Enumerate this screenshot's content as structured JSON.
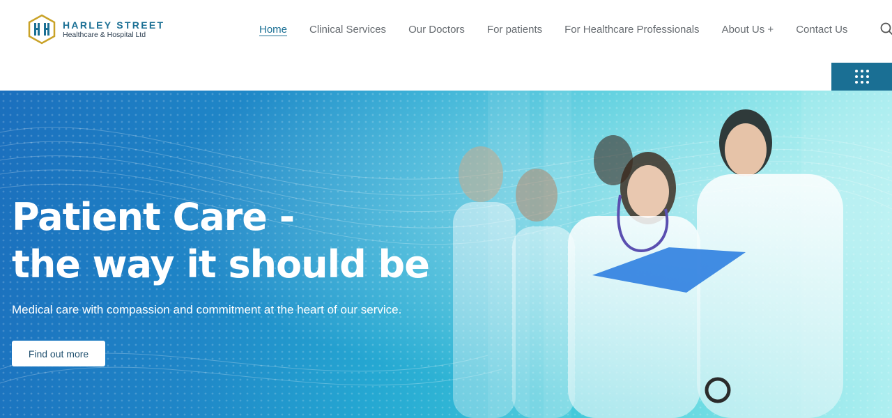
{
  "logo": {
    "title": "HARLEY STREET",
    "subtitle": "Healthcare & Hospital Ltd"
  },
  "nav": {
    "items": [
      {
        "label": "Home",
        "active": true
      },
      {
        "label": "Clinical Services",
        "active": false
      },
      {
        "label": "Our Doctors",
        "active": false
      },
      {
        "label": "For patients",
        "active": false
      },
      {
        "label": "For Healthcare Professionals",
        "active": false
      },
      {
        "label": "About Us +",
        "active": false
      },
      {
        "label": "Contact Us",
        "active": false
      }
    ],
    "search_icon": "search-icon",
    "menu_icon": "grid-dots-icon"
  },
  "hero": {
    "title_line1": "Patient Care -",
    "title_line2": "the way it should be",
    "subtitle": "Medical care with compassion and commitment at the heart of our service.",
    "cta_label": "Find out more"
  },
  "colors": {
    "brand": "#1a6f94",
    "logo_gold": "#c9a227",
    "hero_start": "#1b6fbd",
    "hero_end": "#a8eef0"
  }
}
